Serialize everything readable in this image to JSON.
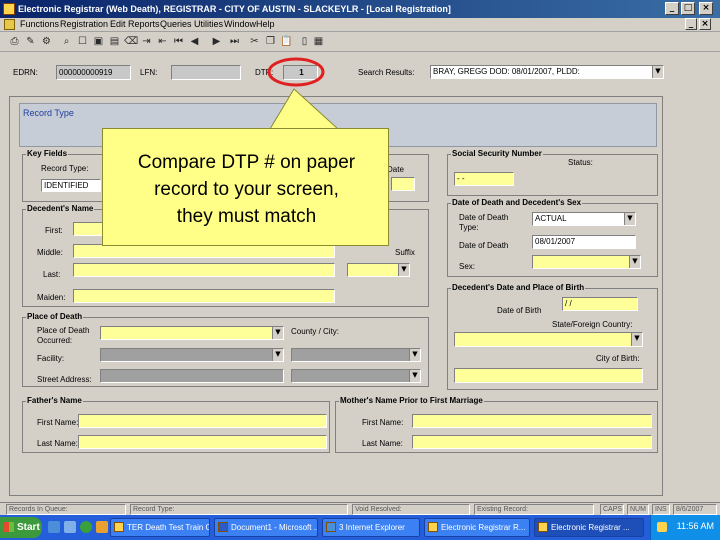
{
  "window": {
    "title": "Electronic Registrar (Web Death), REGISTRAR - CITY OF AUSTIN - SLACKEYLR - [Local Registration]"
  },
  "menu": [
    "Functions",
    "Registration",
    "Edit",
    "Reports",
    "Queries",
    "Utilities",
    "Window",
    "Help"
  ],
  "top": {
    "edrn_label": "EDRN:",
    "edrn_value": "000000000919",
    "lfn_label": "LFN:",
    "lfn_value": "",
    "dtp_label": "DTP:",
    "dtp_value": "1",
    "search_label": "Search Results:",
    "search_value": "BRAY, GREGG  DOD: 08/01/2007, PLDD:"
  },
  "main": {
    "record_type_title": "Record Type"
  },
  "key_fields": {
    "title": "Key Fields",
    "record_type_label": "Record Type:",
    "record_type_value": "IDENTIFIED",
    "date_label": "Date"
  },
  "ssn": {
    "title": "Social Security Number",
    "status_label": "Status:",
    "value": "- -"
  },
  "death_sex": {
    "title": "Date of Death and Decedent's Sex",
    "dod_type_label_1": "Date of Death",
    "dod_type_label_2": "Type:",
    "dod_type_value": "ACTUAL",
    "dod_label": "Date of Death",
    "dod_value": "08/01/2007",
    "sex_label": "Sex:"
  },
  "decedent_name": {
    "title": "Decedent's Name",
    "first_label": "First:",
    "middle_label": "Middle:",
    "last_label": "Last:",
    "suffix_label": "Suffix",
    "maiden_label": "Maiden:"
  },
  "birth": {
    "title": "Decedent's Date and Place of Birth",
    "dob_label": "Date of Birth",
    "dob_value": "/ /",
    "state_label": "State/Foreign Country:",
    "city_label": "City of Birth:"
  },
  "place_of_death": {
    "title": "Place of Death",
    "place_label_1": "Place of Death",
    "place_label_2": "Occurred:",
    "county_city_label": "County / City:",
    "facility_label": "Facility:",
    "street_label": "Street Address:"
  },
  "father": {
    "title": "Father's Name",
    "first_label": "First Name:",
    "last_label": "Last Name:"
  },
  "mother": {
    "title": "Mother's Name Prior to First Marriage",
    "first_label": "First Name:",
    "last_label": "Last Name:"
  },
  "callout": {
    "line1": "Compare DTP # on paper",
    "line2": "record to your screen,",
    "line3": "they must match"
  },
  "status_bar": {
    "records_in_queue": "Records In Queue:",
    "record_type": "Record Type:",
    "void_resolved": "Void Resolved:",
    "existing_record": "Existing Record:",
    "caps": "CAPS",
    "num": "NUM",
    "ins": "INS",
    "date": "8/6/2007"
  },
  "taskbar": {
    "start": "Start",
    "tasks": [
      "TER Death Test Train Gi...",
      "Document1 - Microsoft ...",
      "3 Internet Explorer",
      "Electronic Registrar R...",
      "Electronic Registrar ..."
    ],
    "clock": "11:56 AM"
  },
  "colors": {
    "title_bar": "#0a246a",
    "required_field": "#ffff99",
    "callout_fill": "#ffff88",
    "highlight_circle": "#e02020"
  }
}
